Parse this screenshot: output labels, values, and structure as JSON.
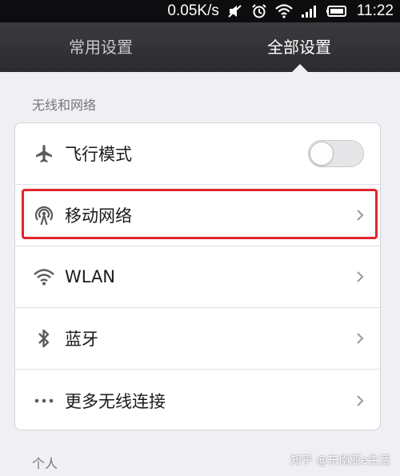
{
  "status_bar": {
    "speed": "0.05K/s",
    "time": "11:22",
    "icons": [
      "mute-icon",
      "alarm-icon",
      "wifi-icon",
      "signal-icon",
      "battery-icon"
    ]
  },
  "tabs": [
    {
      "label": "常用设置",
      "active": false
    },
    {
      "label": "全部设置",
      "active": true
    }
  ],
  "sections": {
    "wireless_title": "无线和网络",
    "personal_title": "个人"
  },
  "rows": [
    {
      "label": "飞行模式",
      "icon": "airplane-icon",
      "control": "toggle",
      "toggle_on": false
    },
    {
      "label": "移动网络",
      "icon": "mobile-network-icon",
      "control": "chevron",
      "highlighted": true
    },
    {
      "label": "WLAN",
      "icon": "wifi-icon",
      "control": "chevron"
    },
    {
      "label": "蓝牙",
      "icon": "bluetooth-icon",
      "control": "chevron"
    },
    {
      "label": "更多无线连接",
      "icon": "more-icon",
      "control": "chevron"
    }
  ],
  "colors": {
    "highlight": "#e0262b",
    "tabbar": "#2b2c2f",
    "background": "#efeff4"
  },
  "watermark": "知乎 @东南亚e生活"
}
